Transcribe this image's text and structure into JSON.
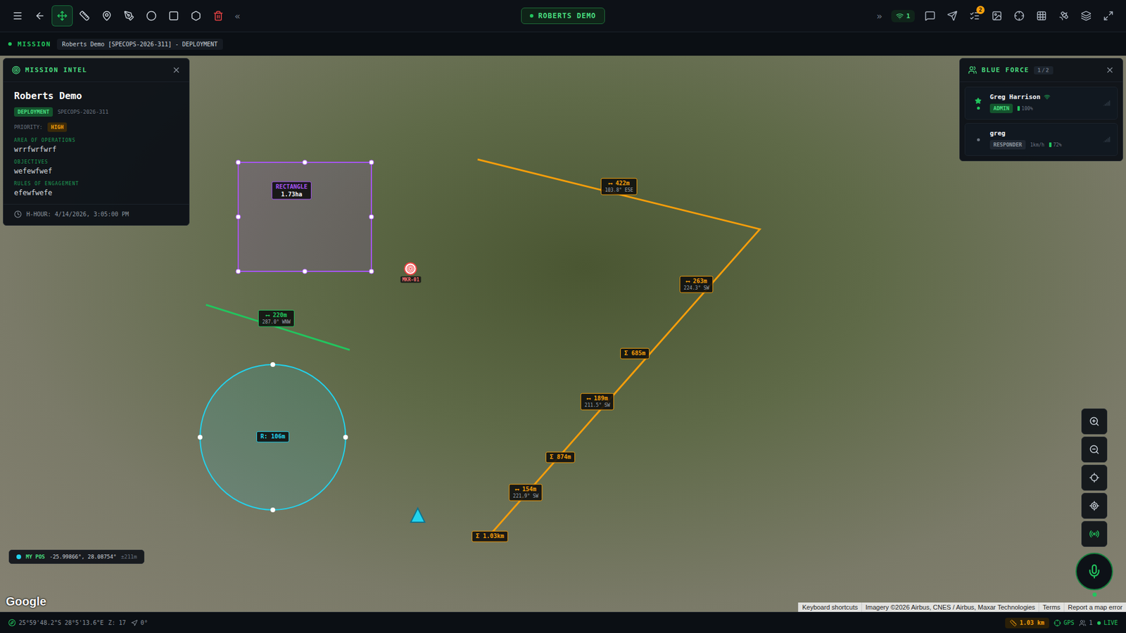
{
  "toolbar": {
    "tools": [
      {
        "selected": false,
        "color": "#c9d1d9"
      },
      {
        "selected": false,
        "color": "#c9d1d9"
      },
      {
        "selected": true,
        "color": "#22c55e"
      },
      {
        "selected": false,
        "color": "#c9d1d9"
      },
      {
        "selected": false,
        "color": "#c9d1d9"
      },
      {
        "selected": false,
        "color": "#c9d1d9"
      },
      {
        "selected": false,
        "color": "#c9d1d9"
      },
      {
        "selected": false,
        "color": "#c9d1d9"
      },
      {
        "selected": false,
        "color": "#c9d1d9"
      },
      {
        "selected": false,
        "color": "#ef4444"
      }
    ],
    "collapse_glyph": "«",
    "title": "ROBERTS DEMO",
    "expand_glyph": "»",
    "connections": "1",
    "tasks_badge": "2"
  },
  "mission_bar": {
    "label": "MISSION",
    "text": "Roberts Demo [SPECOPS-2026-311] - DEPLOYMENT"
  },
  "mission_intel": {
    "header": "MISSION INTEL",
    "title": "Roberts Demo",
    "status": "DEPLOYMENT",
    "code": "SPECOPS-2026-311",
    "priority_label": "PRIORITY:",
    "priority": "HIGH",
    "fields": [
      {
        "label": "AREA OF OPERATIONS",
        "value": "wrrfwrfwrf"
      },
      {
        "label": "OBJECTIVES",
        "value": "wefewfwef"
      },
      {
        "label": "RULES OF ENGAGEMENT",
        "value": "efewfwefe"
      }
    ],
    "h_hour": "H-HOUR: 4/14/2026, 3:05:00 PM"
  },
  "blue_force": {
    "header": "BLUE FORCE",
    "count": "1/2",
    "members": [
      {
        "name": "Greg Harrison",
        "role": "ADMIN",
        "speed": "",
        "battery": "100%",
        "online": true,
        "is_self": true
      },
      {
        "name": "greg",
        "role": "RESPONDER",
        "speed": "1km/h",
        "battery": "72%",
        "online": false,
        "is_self": false
      }
    ]
  },
  "map": {
    "shapes": [
      {
        "kind": "rectangle",
        "color": "#a855f7",
        "title": "RECTANGLE",
        "value": "1.73ha"
      },
      {
        "kind": "line",
        "color": "#22c55e",
        "glyph": "⟷",
        "distance": "220m",
        "bearing": "287.0° WNW"
      },
      {
        "kind": "circle",
        "color": "#22d3ee",
        "value": "R: 106m"
      },
      {
        "kind": "route",
        "color": "#f59e0b",
        "glyph": "⟷",
        "segments": [
          {
            "distance": "422m",
            "bearing": "103.8° ESE"
          },
          {
            "distance": "263m",
            "bearing": "224.3° SW"
          },
          {
            "distance": "189m",
            "bearing": "211.5° SW"
          },
          {
            "distance": "154m",
            "bearing": "221.9° SW"
          }
        ],
        "totals": [
          "Σ 685m",
          "Σ 874m",
          "Σ 1.03km"
        ]
      }
    ],
    "marker": {
      "label": "MKR-01"
    },
    "my_pos": {
      "label": "MY POS",
      "coords": "-25.99866°, 28.08754°",
      "accuracy": "±211m"
    },
    "logo": "Google",
    "attribution": [
      "Keyboard shortcuts",
      "Imagery ©2026 Airbus, CNES / Airbus, Maxar Technologies",
      "Terms",
      "Report a map error"
    ]
  },
  "status_bar": {
    "coords": "25°59'48.2\"S 28°5'13.6\"E",
    "zoom": "Z: 17",
    "heading": "0°",
    "distance": "1.03 km",
    "gps": "GPS",
    "users": "1",
    "live": "LIVE"
  }
}
